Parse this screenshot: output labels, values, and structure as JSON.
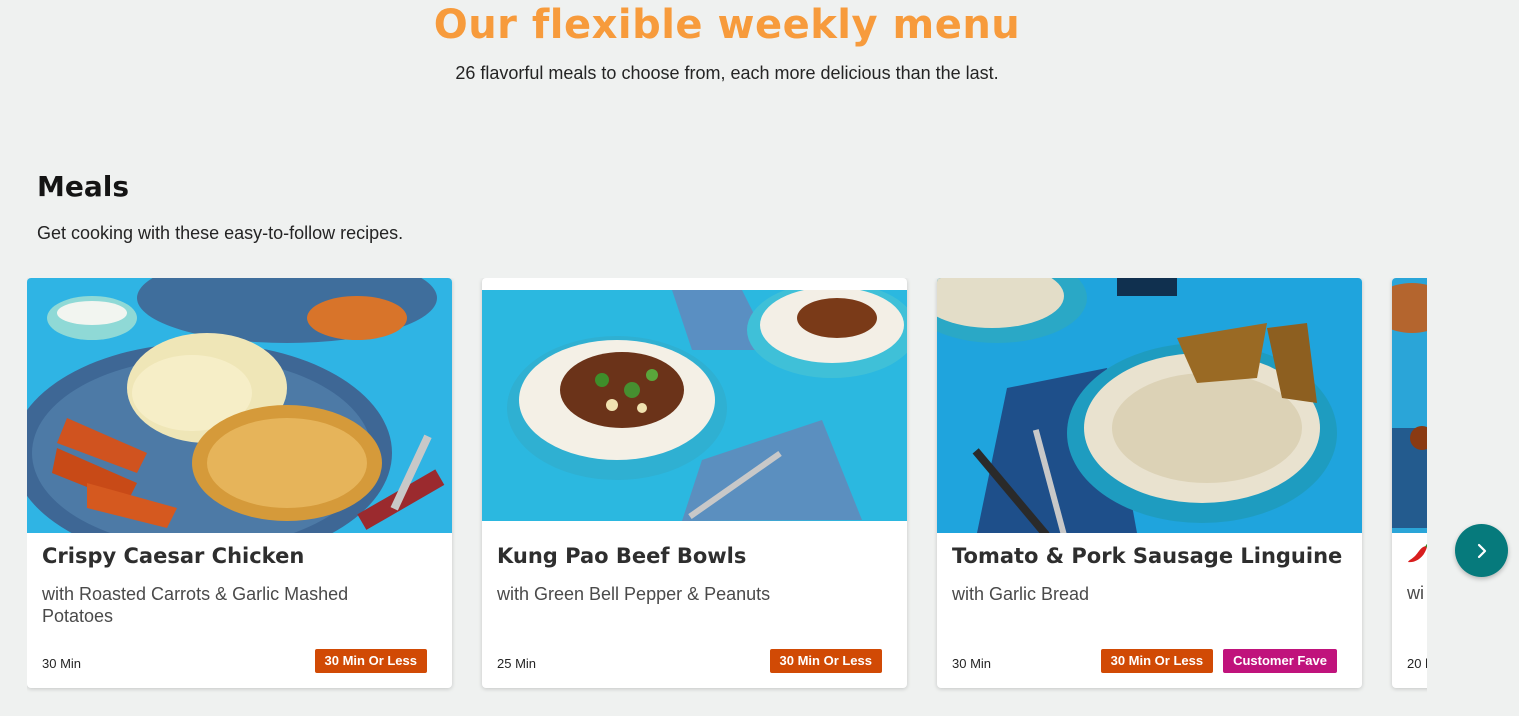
{
  "hero": {
    "title": "Our flexible weekly menu",
    "subtitle": "26 flavorful meals to choose from, each more delicious than the last."
  },
  "section": {
    "title": "Meals",
    "subtitle": "Get cooking with these easy-to-follow recipes."
  },
  "cards": [
    {
      "title": "Crispy Caesar Chicken",
      "description": "with Roasted Carrots & Garlic Mashed Potatoes",
      "time": "30 Min",
      "tags": [
        "30 Min Or Less"
      ],
      "image_icon": "chicken-plate-photo"
    },
    {
      "title": "Kung Pao Beef Bowls",
      "description": "with Green Bell Pepper & Peanuts",
      "time": "25 Min",
      "tags": [
        "30 Min Or Less"
      ],
      "image_icon": "beef-bowl-photo"
    },
    {
      "title": "Tomato & Pork Sausage Linguine",
      "description": "with Garlic Bread",
      "time": "30 Min",
      "tags": [
        "30 Min Or Less",
        "Customer Fave"
      ],
      "image_icon": "linguine-bowl-photo"
    },
    {
      "description": "wi",
      "time": "20 l",
      "icon": "chili-pepper-icon"
    }
  ],
  "carousel": {
    "next_icon": "chevron-right-icon"
  },
  "colors": {
    "accent": "#f79b3c",
    "tag_orange": "#d14a05",
    "tag_pink": "#c0137c",
    "nav_button": "#067a7c"
  }
}
